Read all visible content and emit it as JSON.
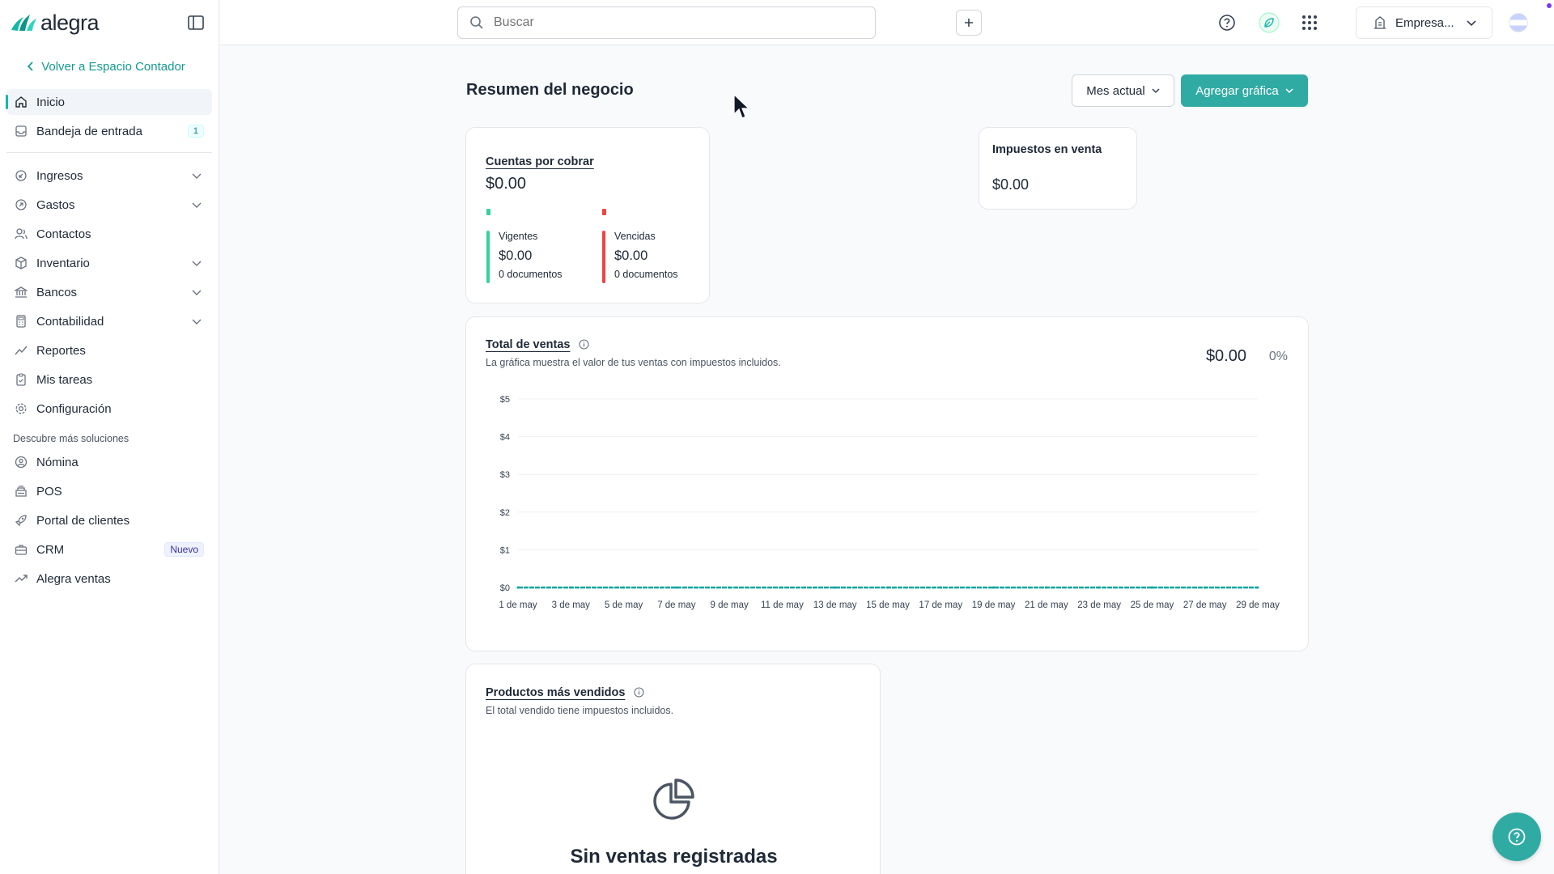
{
  "brand": {
    "name": "alegra",
    "accent": "#30aba3",
    "teal": "#14b8a6"
  },
  "sidebar": {
    "back_link": "Volver a Espacio Contador",
    "items": [
      {
        "label": "Inicio",
        "icon": "home-icon",
        "active": true
      },
      {
        "label": "Bandeja de entrada",
        "icon": "inbox-icon",
        "badge": "1"
      },
      {
        "label": "Ingresos",
        "icon": "income-icon",
        "expandable": true
      },
      {
        "label": "Gastos",
        "icon": "expenses-icon",
        "expandable": true
      },
      {
        "label": "Contactos",
        "icon": "contacts-icon"
      },
      {
        "label": "Inventario",
        "icon": "box-icon",
        "expandable": true
      },
      {
        "label": "Bancos",
        "icon": "bank-icon",
        "expandable": true
      },
      {
        "label": "Contabilidad",
        "icon": "calculator-icon",
        "expandable": true
      },
      {
        "label": "Reportes",
        "icon": "chart-line-icon"
      },
      {
        "label": "Mis tareas",
        "icon": "clipboard-icon"
      },
      {
        "label": "Configuración",
        "icon": "gear-icon"
      }
    ],
    "solutions_label": "Descubre más soluciones",
    "solutions": [
      {
        "label": "Nómina",
        "icon": "payroll-icon"
      },
      {
        "label": "POS",
        "icon": "pos-icon"
      },
      {
        "label": "Portal de clientes",
        "icon": "rocket-icon"
      },
      {
        "label": "CRM",
        "icon": "briefcase-icon",
        "badge": "Nuevo"
      },
      {
        "label": "Alegra ventas",
        "icon": "trend-icon"
      }
    ]
  },
  "topbar": {
    "search_placeholder": "Buscar",
    "company": "Empresa..."
  },
  "page": {
    "title": "Resumen del negocio",
    "period_button": "Mes actual",
    "add_chart_button": "Agregar gráfica"
  },
  "cxc": {
    "title": "Cuentas por cobrar",
    "amount": "$0.00",
    "current": {
      "label": "Vigentes",
      "amount": "$0.00",
      "docs": "0 documentos",
      "color": "#34d399"
    },
    "overdue": {
      "label": "Vencidas",
      "amount": "$0.00",
      "docs": "0 documentos",
      "color": "#ef4444"
    }
  },
  "taxes": {
    "title": "Impuestos en venta",
    "amount": "$0.00"
  },
  "sales": {
    "title": "Total de ventas",
    "subtitle": "La gráfica muestra el valor de tus ventas con impuestos incluidos.",
    "amount": "$0.00",
    "percent": "0%"
  },
  "chart_data": {
    "type": "line",
    "title": "Total de ventas",
    "x": [
      "1 de may",
      "3 de may",
      "5 de may",
      "7 de may",
      "9 de may",
      "11 de may",
      "13 de may",
      "15 de may",
      "17 de may",
      "19 de may",
      "21 de may",
      "23 de may",
      "25 de may",
      "27 de may",
      "29 de may"
    ],
    "series": [
      {
        "values": [
          0,
          0,
          0,
          0,
          0,
          0,
          0,
          0,
          0,
          0,
          0,
          0,
          0,
          0,
          0
        ],
        "color": "#0ea5a0"
      }
    ],
    "y_ticks": [
      "$0",
      "$1",
      "$2",
      "$3",
      "$4",
      "$5"
    ],
    "ylim": [
      0,
      5
    ],
    "grid": true
  },
  "top_products": {
    "title": "Productos más vendidos",
    "subtitle": "El total vendido tiene impuestos incluidos.",
    "empty_title": "Sin ventas registradas"
  }
}
